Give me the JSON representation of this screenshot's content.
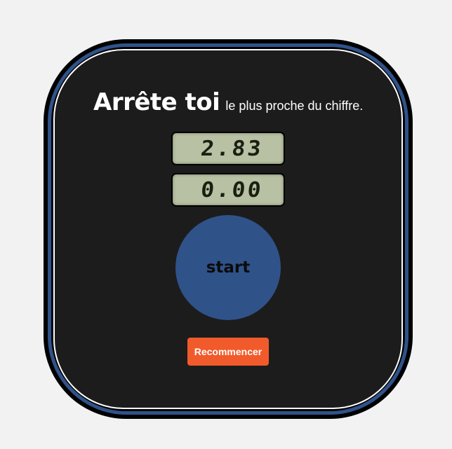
{
  "header": {
    "title": "Arrête toi",
    "subtitle": "le plus proche du chiffre."
  },
  "displays": {
    "target_value": "2.83",
    "timer_value": "0.00"
  },
  "controls": {
    "start_label": "start",
    "reset_label": "Recommencer"
  },
  "colors": {
    "panel": "#1c1c1c",
    "accent_blue": "#2f5289",
    "lcd_bg": "#b8c1a3",
    "reset_orange": "#f15a2b"
  }
}
